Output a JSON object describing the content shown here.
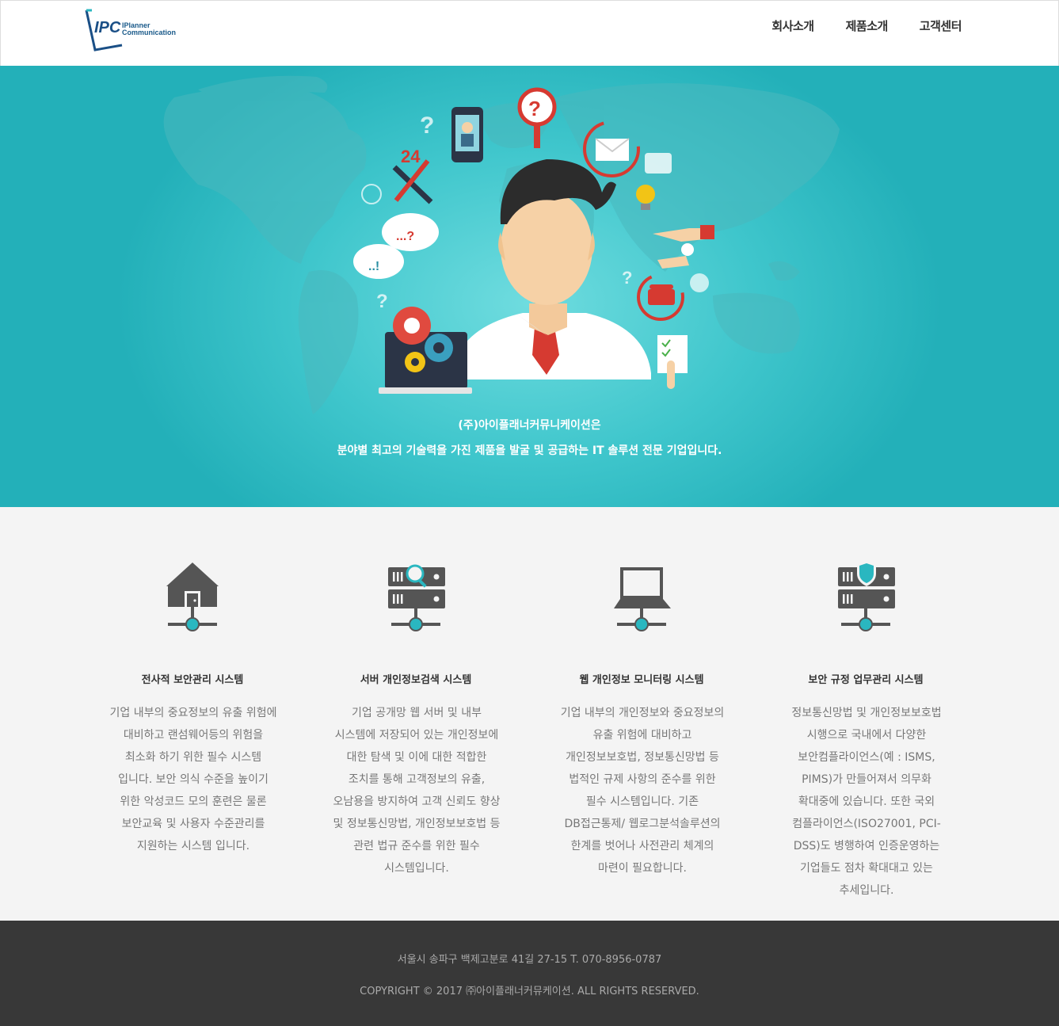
{
  "header": {
    "logo_text": "IPC",
    "logo_sub_line1": "IPlanner",
    "logo_sub_line2": "Communication",
    "nav": [
      "회사소개",
      "제품소개",
      "고객센터"
    ]
  },
  "hero": {
    "line1": "(주)아이플래너커뮤니케이션은",
    "line2": "분야별 최고의 기술력을 가진 제품을 발굴 및 공급하는 IT 솔루션 전문 기업입니다.",
    "badge_24": "24"
  },
  "features": [
    {
      "title": "전사적 보안관리 시스템",
      "desc": "기업 내부의 중요정보의 유출 위험에 대비하고 랜섬웨어등의 위험을 최소화 하기 위한 필수 시스템 입니다. 보안 의식 수준을 높이기 위한 악성코드 모의 훈련은 물론 보안교육 및 사용자 수준관리를 지원하는 시스템 입니다.",
      "icon": "house-network-icon"
    },
    {
      "title": "서버 개인정보검색 시스템",
      "desc": "기업 공개망 웹 서버 및 내부 시스템에 저장되어 있는 개인정보에 대한 탐색 및 이에 대한 적합한 조치를 통해 고객정보의 유출, 오남용을 방지하여 고객 신뢰도 향상 및 정보통신망법, 개인정보보호법 등 관련 법규 준수를 위한 필수 시스템입니다.",
      "icon": "server-search-icon"
    },
    {
      "title": "웹 개인정보 모니터링 시스템",
      "desc": "기업 내부의 개인정보와 중요정보의 유출 위험에 대비하고 개인정보보호법, 정보통신망법 등 법적인 규제 사항의 준수를 위한 필수 시스템입니다. 기존 DB접근통제/ 웹로그분석솔루션의 한계를 벗어나 사전관리 체계의 마련이 필요합니다.",
      "icon": "laptop-network-icon"
    },
    {
      "title": "보안 규정 업무관리 시스템",
      "desc": "정보통신망법 및 개인정보보호법 시행으로 국내에서 다양한 보안컴플라이언스(예 : ISMS, PIMS)가 만들어져서 의무화 확대중에 있습니다. 또한 국외 컴플라이언스(ISO27001, PCI-DSS)도 병행하여 인증운영하는 기업들도 점차 확대대고 있는 추세입니다.",
      "icon": "server-shield-icon"
    }
  ],
  "footer": {
    "address": "서울시 송파구 백제고분로 41길 27-15 T. 070-8956-0787",
    "copyright": "COPYRIGHT © 2017 ㈜아이플래너커뮤케이션. ALL RIGHTS RESERVED."
  }
}
